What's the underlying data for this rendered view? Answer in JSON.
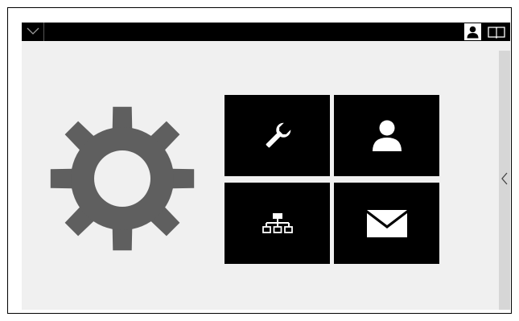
{
  "topbar": {
    "icons": [
      "chevron-down-icon",
      "user-icon",
      "book-icon"
    ]
  },
  "main": {
    "hero_icon": "gear-icon",
    "tiles": [
      {
        "icon": "wrench-icon"
      },
      {
        "icon": "user-icon"
      },
      {
        "icon": "network-icon"
      },
      {
        "icon": "envelope-icon"
      }
    ]
  },
  "sidebar": {
    "collapse_icon": "chevron-left-icon"
  },
  "colors": {
    "topbar_bg": "#000000",
    "content_bg": "#f0f0f0",
    "tile_bg": "#000000",
    "gear": "#5f5f5f",
    "sidebar_handle": "#d6d6d6"
  }
}
